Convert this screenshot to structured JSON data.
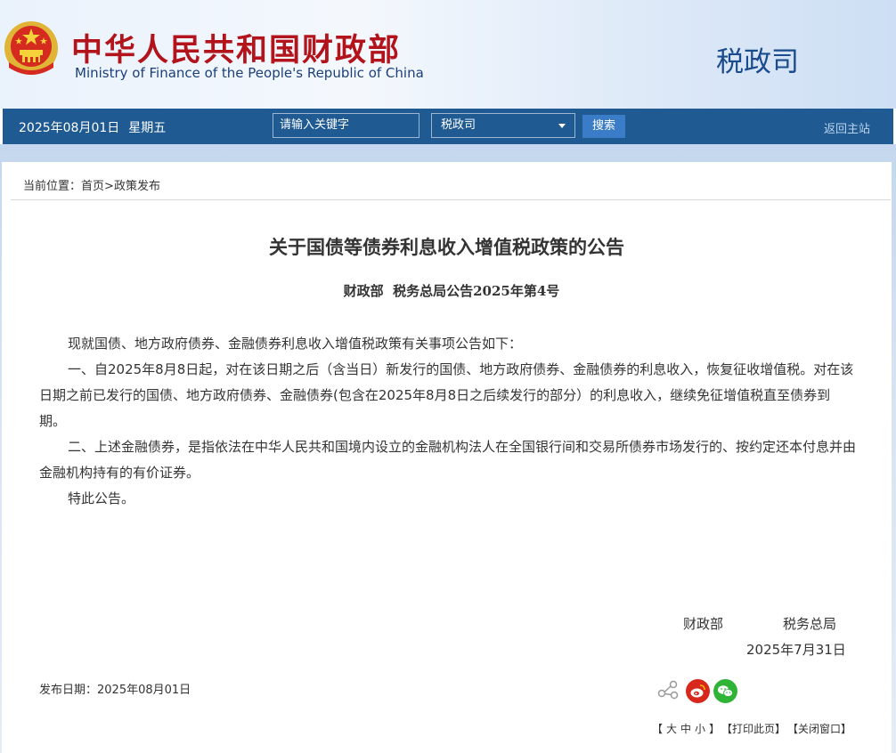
{
  "header": {
    "title_cn": "中华人民共和国财政部",
    "title_en": "Ministry of Finance of the People's Republic of China",
    "department": "税政司"
  },
  "navbar": {
    "date": "2025年08月01日",
    "weekday": "星期五",
    "search_placeholder": "请输入关键字",
    "scope_selected": "税政司",
    "search_button": "搜索",
    "home_link": "返回主站"
  },
  "breadcrumb": {
    "prefix": "当前位置：",
    "home": "首页",
    "separator": ">",
    "section": "政策发布"
  },
  "article": {
    "title": "关于国债等债券利息收入增值税政策的公告",
    "doc_number": "财政部  税务总局公告2025年第4号",
    "paragraphs": [
      "现就国债、地方政府债券、金融债券利息收入增值税政策有关事项公告如下：",
      "一、自2025年8月8日起，对在该日期之后（含当日）新发行的国债、地方政府债券、金融债券的利息收入，恢复征收增值税。对在该日期之前已发行的国债、地方政府债券、金融债券(包含在2025年8月8日之后续发行的部分）的利息收入，继续免征增值税直至债券到期。",
      "二、上述金融债券，是指依法在中华人民共和国境内设立的金融机构法人在全国银行间和交易所债券市场发行的、按约定还本付息并由金融机构持有的有价证券。",
      "特此公告。"
    ],
    "signer_1": "财政部",
    "signer_2": "税务总局",
    "sign_date": "2025年7月31日"
  },
  "footer": {
    "publish_label": "发布日期：",
    "publish_date": "2025年08月01日",
    "font_open": "【",
    "font_large": "大",
    "font_medium": "中",
    "font_small": "小",
    "font_close": "】",
    "print": "【打印此页】",
    "close": "【关闭窗口】",
    "icons": [
      "share-icon",
      "weibo-icon",
      "wechat-icon"
    ]
  },
  "colors": {
    "brand_red": "#b3131b",
    "nav_blue": "#1f5a92",
    "button_blue": "#3b7cc9",
    "weibo_red": "#d7281b",
    "wechat_green": "#2fb438"
  }
}
